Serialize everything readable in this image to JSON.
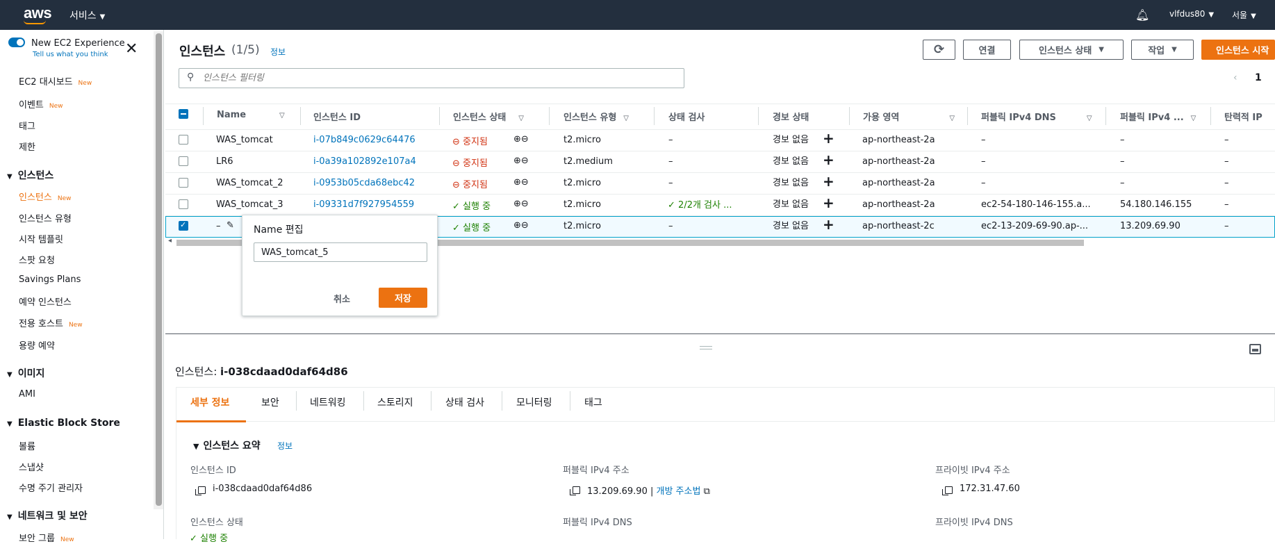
{
  "topbar": {
    "logo": "aws",
    "services": "서비스",
    "user": "vlfdus80",
    "region": "서울"
  },
  "sidebar": {
    "new_experience": "New EC2 Experience",
    "tell_us": "Tell us what you think",
    "items": [
      {
        "label": "EC2 대시보드",
        "badge": "New"
      },
      {
        "label": "이벤트",
        "badge": "New"
      },
      {
        "label": "태그",
        "badge": ""
      },
      {
        "label": "제한",
        "badge": ""
      }
    ],
    "sections": [
      {
        "label": "인스턴스",
        "items": [
          {
            "label": "인스턴스",
            "badge": "New"
          },
          {
            "label": "인스턴스 유형",
            "badge": ""
          },
          {
            "label": "시작 템플릿",
            "badge": ""
          },
          {
            "label": "스팟 요청",
            "badge": ""
          },
          {
            "label": "Savings Plans",
            "badge": ""
          },
          {
            "label": "예약 인스턴스",
            "badge": ""
          },
          {
            "label": "전용 호스트",
            "badge": "New"
          },
          {
            "label": "용량 예약",
            "badge": ""
          }
        ]
      },
      {
        "label": "이미지",
        "items": [
          {
            "label": "AMI",
            "badge": ""
          }
        ]
      },
      {
        "label": "Elastic Block Store",
        "items": [
          {
            "label": "볼륨",
            "badge": ""
          },
          {
            "label": "스냅샷",
            "badge": ""
          },
          {
            "label": "수명 주기 관리자",
            "badge": ""
          }
        ]
      },
      {
        "label": "네트워크 및 보안",
        "items": [
          {
            "label": "보안 그룹",
            "badge": "New"
          }
        ]
      }
    ]
  },
  "header": {
    "title": "인스턴스",
    "count": "(1/5)",
    "info": "정보",
    "connect": "연결",
    "instance_state": "인스턴스 상태",
    "actions": "작업",
    "launch": "인스턴스 시작",
    "page": "1"
  },
  "search": {
    "placeholder": "인스턴스 필터링"
  },
  "table": {
    "headers": [
      "Name",
      "인스턴스 ID",
      "인스턴스 상태",
      "인스턴스 유형",
      "상태 검사",
      "경보 상태",
      "가용 영역",
      "퍼블릭 IPv4 DNS",
      "퍼블릭 IPv4 ...",
      "탄력적 IP"
    ],
    "rows": [
      {
        "name": "WAS_tomcat",
        "id": "i-07b849c0629c64476",
        "state": "중지됨",
        "state_kind": "stopped",
        "type": "t2.micro",
        "check": "–",
        "alarm": "경보 없음",
        "az": "ap-northeast-2a",
        "dns": "–",
        "ip": "–",
        "eip": "–",
        "selected": false
      },
      {
        "name": "LR6",
        "id": "i-0a39a102892e107a4",
        "state": "중지됨",
        "state_kind": "stopped",
        "type": "t2.medium",
        "check": "–",
        "alarm": "경보 없음",
        "az": "ap-northeast-2a",
        "dns": "–",
        "ip": "–",
        "eip": "–",
        "selected": false
      },
      {
        "name": "WAS_tomcat_2",
        "id": "i-0953b05cda68ebc42",
        "state": "중지됨",
        "state_kind": "stopped",
        "type": "t2.micro",
        "check": "–",
        "alarm": "경보 없음",
        "az": "ap-northeast-2a",
        "dns": "–",
        "ip": "–",
        "eip": "–",
        "selected": false
      },
      {
        "name": "WAS_tomcat_3",
        "id": "i-09331d7f927954559",
        "state": "실행 중",
        "state_kind": "running",
        "type": "t2.micro",
        "check": "2/2개 검사 ...",
        "alarm": "경보 없음",
        "az": "ap-northeast-2a",
        "dns": "ec2-54-180-146-155.a...",
        "ip": "54.180.146.155",
        "eip": "–",
        "selected": false
      },
      {
        "name": "–",
        "id": "",
        "state": "실행 중",
        "state_kind": "running",
        "type": "t2.micro",
        "check": "–",
        "alarm": "경보 없음",
        "az": "ap-northeast-2c",
        "dns": "ec2-13-209-69-90.ap-...",
        "ip": "13.209.69.90",
        "eip": "–",
        "selected": true
      }
    ]
  },
  "popover": {
    "title": "Name 편집",
    "value": "WAS_tomcat_5",
    "cancel": "취소",
    "save": "저장"
  },
  "details": {
    "title_prefix": "인스턴스: ",
    "title_id": "i-038cdaad0daf64d86",
    "tabs": [
      "세부 정보",
      "보안",
      "네트워킹",
      "스토리지",
      "상태 검사",
      "모니터링",
      "태그"
    ],
    "summary": "인스턴스 요약",
    "summary_info": "정보",
    "instance_id_label": "인스턴스 ID",
    "instance_id": "i-038cdaad0daf64d86",
    "public_ip_label": "퍼블릭 IPv4 주소",
    "public_ip": "13.209.69.90",
    "open_address": "개방 주소법",
    "private_ip_label": "프라이빗 IPv4 주소",
    "private_ip": "172.31.47.60",
    "state_label": "인스턴스 상태",
    "state": "실행 중",
    "public_dns_label": "퍼블릭 IPv4 DNS",
    "private_dns_label": "프라이빗 IPv4 DNS"
  }
}
